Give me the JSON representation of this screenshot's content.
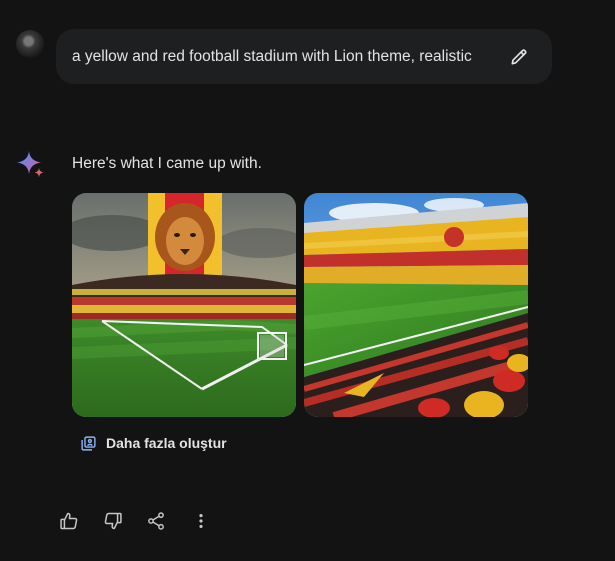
{
  "user": {
    "prompt": "a yellow and red football stadium with Lion theme, realistic",
    "edit_icon": "pencil-icon"
  },
  "response": {
    "intro": "Here's what I came up with.",
    "images": [
      {
        "name": "generated-image-1"
      },
      {
        "name": "generated-image-2"
      }
    ],
    "generate_more_label": "Daha fazla oluştur"
  },
  "actions": [
    {
      "name": "thumbs-up-button",
      "icon": "thumb-up-icon"
    },
    {
      "name": "thumbs-down-button",
      "icon": "thumb-down-icon"
    },
    {
      "name": "share-button",
      "icon": "share-icon"
    },
    {
      "name": "more-options-button",
      "icon": "more-vert-icon"
    }
  ],
  "colors": {
    "background": "#131314",
    "bubble": "#1e1f20",
    "text": "#e3e3e3",
    "accent_blue": "#8ab4f8"
  }
}
